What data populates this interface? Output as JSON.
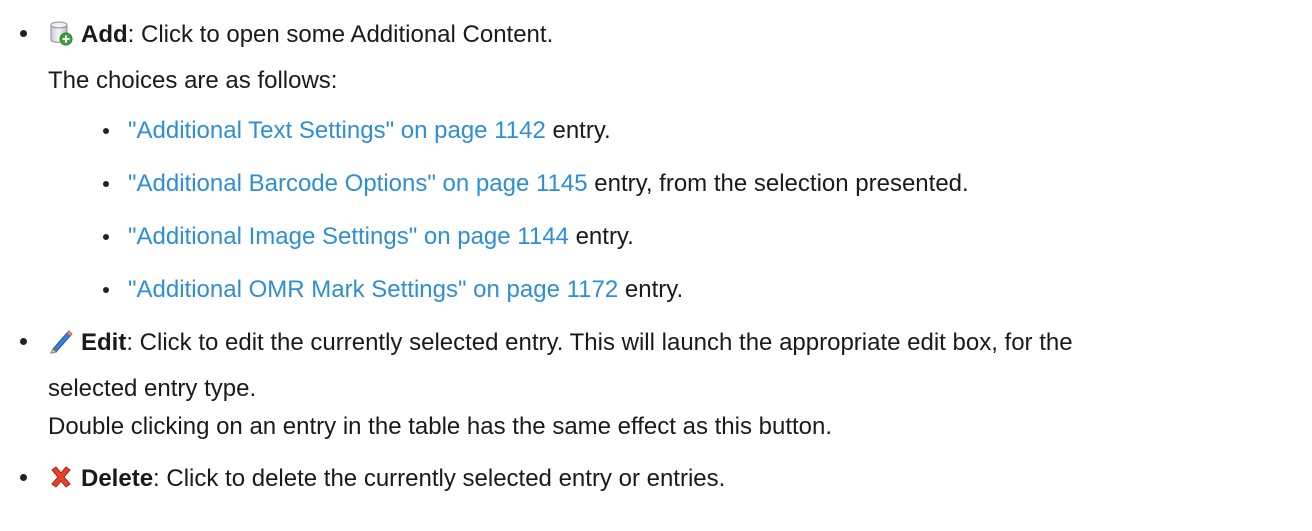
{
  "items": [
    {
      "icon": "database-add-icon",
      "label": "Add",
      "desc": ": Click to open some Additional Content.",
      "note": "The choices are as follows:",
      "choices": [
        {
          "link": "\"Additional Text Settings\" on page 1142",
          "rest": " entry."
        },
        {
          "link": "\"Additional Barcode Options\" on page 1145",
          "rest": " entry, from the selection presented."
        },
        {
          "link": "\"Additional Image Settings\" on page 1144",
          "rest": " entry."
        },
        {
          "link": "\"Additional OMR Mark Settings\" on page 1172",
          "rest": " entry."
        }
      ]
    },
    {
      "icon": "pencil-edit-icon",
      "label": "Edit",
      "desc": ": Click to edit the currently selected entry. This will launch the appropriate edit box, for the",
      "desc2": "selected entry type.",
      "note": "Double clicking on an entry in the table has the same effect as this button."
    },
    {
      "icon": "red-x-delete-icon",
      "label": "Delete",
      "desc": ": Click to delete the currently selected entry or entries."
    }
  ]
}
